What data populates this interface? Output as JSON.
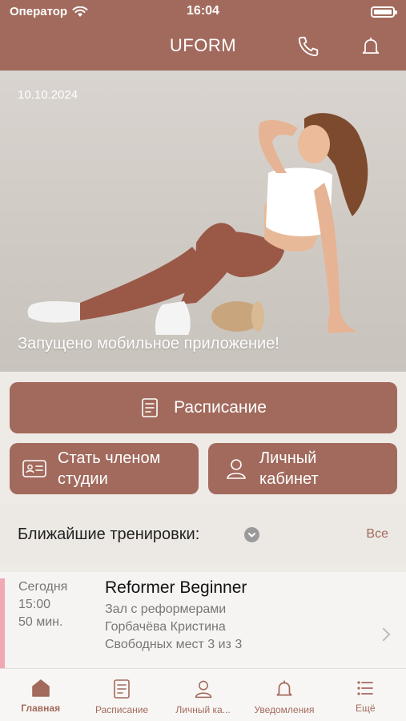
{
  "status_bar": {
    "carrier": "Оператор",
    "time": "16:04"
  },
  "header": {
    "title": "UFORM"
  },
  "hero": {
    "date": "10.10.2024",
    "caption": "Запущено мобильное приложение!"
  },
  "actions": {
    "schedule_label": "Расписание",
    "membership_label": "Стать членом\nстудии",
    "account_label": "Личный\nкабинет"
  },
  "upcoming": {
    "title": "Ближайшие тренировки:",
    "all_label": "Все",
    "items": [
      {
        "day": "Сегодня",
        "time": "15:00",
        "duration": "50 мин.",
        "title": "Reformer Beginner",
        "room": "Зал с реформерами",
        "trainer": "Горбачёва Кристина",
        "spots": "Свободных мест 3 из 3"
      }
    ]
  },
  "tabbar": {
    "items": [
      {
        "label": "Главная",
        "icon": "home-icon"
      },
      {
        "label": "Расписание",
        "icon": "schedule-icon"
      },
      {
        "label": "Личный ка...",
        "icon": "profile-icon"
      },
      {
        "label": "Уведомления",
        "icon": "bell-icon"
      },
      {
        "label": "Ещё",
        "icon": "list-icon"
      }
    ]
  },
  "colors": {
    "brand": "#a26a5d",
    "accent": "#f0a9b4",
    "background": "#eeeae6"
  }
}
